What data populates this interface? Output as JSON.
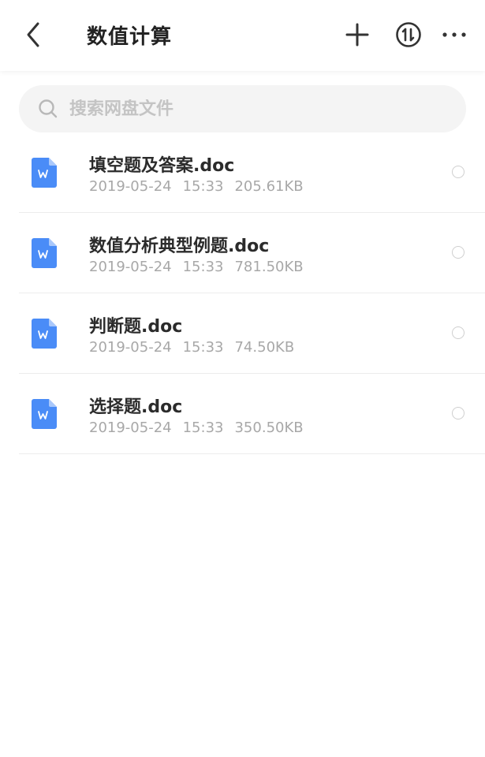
{
  "header": {
    "title": "数值计算",
    "back_icon": "chevron-left-icon",
    "add_icon": "plus-icon",
    "sort_icon": "sort-circle-icon",
    "more_icon": "ellipsis-icon"
  },
  "search": {
    "placeholder": "搜索网盘文件",
    "value": ""
  },
  "files": [
    {
      "name": "填空题及答案.doc",
      "date": "2019-05-24",
      "time": "15:33",
      "size": "205.61KB",
      "icon": "word-doc-icon"
    },
    {
      "name": "数值分析典型例题.doc",
      "date": "2019-05-24",
      "time": "15:33",
      "size": "781.50KB",
      "icon": "word-doc-icon"
    },
    {
      "name": "判断题.doc",
      "date": "2019-05-24",
      "time": "15:33",
      "size": "74.50KB",
      "icon": "word-doc-icon"
    },
    {
      "name": "选择题.doc",
      "date": "2019-05-24",
      "time": "15:33",
      "size": "350.50KB",
      "icon": "word-doc-icon"
    }
  ],
  "colors": {
    "doc_icon": "#4a8cf7",
    "title": "#222222",
    "meta": "#a8a8a8",
    "search_bg": "#f4f4f4"
  }
}
